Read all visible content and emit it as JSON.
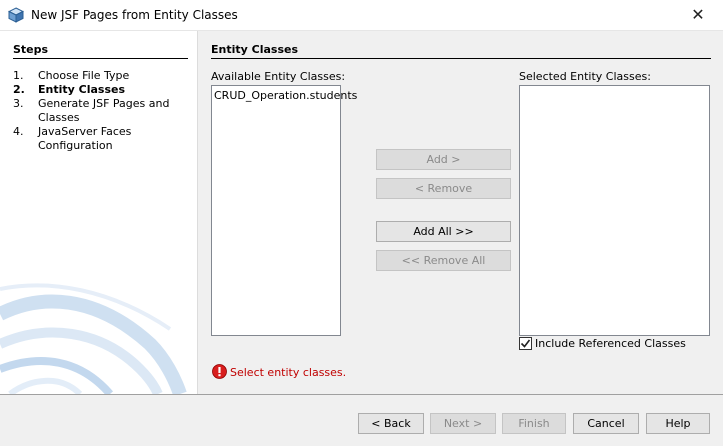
{
  "window": {
    "title": "New JSF Pages from Entity Classes",
    "close_glyph": "✕"
  },
  "steps": {
    "heading": "Steps",
    "items": [
      {
        "num": "1.",
        "label": "Choose File Type",
        "active": false
      },
      {
        "num": "2.",
        "label": "Entity Classes",
        "active": true
      },
      {
        "num": "3.",
        "label": "Generate JSF Pages and",
        "label2": "Classes",
        "active": false
      },
      {
        "num": "4.",
        "label": "JavaServer Faces",
        "label2": "Configuration",
        "active": false
      }
    ]
  },
  "main": {
    "heading": "Entity Classes",
    "available_label": "Available Entity Classes:",
    "selected_label": "Selected Entity Classes:",
    "available_items": [
      "CRUD_Operation.students"
    ],
    "selected_items": [],
    "buttons": {
      "add": "Add >",
      "remove": "< Remove",
      "add_all": "Add All >>",
      "remove_all": "<< Remove All"
    },
    "include_referenced": {
      "label": "Include Referenced Classes",
      "checked": true
    },
    "error_message": "Select entity classes."
  },
  "footer": {
    "back": "< Back",
    "next": "Next >",
    "finish": "Finish",
    "cancel": "Cancel",
    "help": "Help"
  },
  "colors": {
    "error": "#c00000",
    "swoosh": "#c9dcef"
  }
}
